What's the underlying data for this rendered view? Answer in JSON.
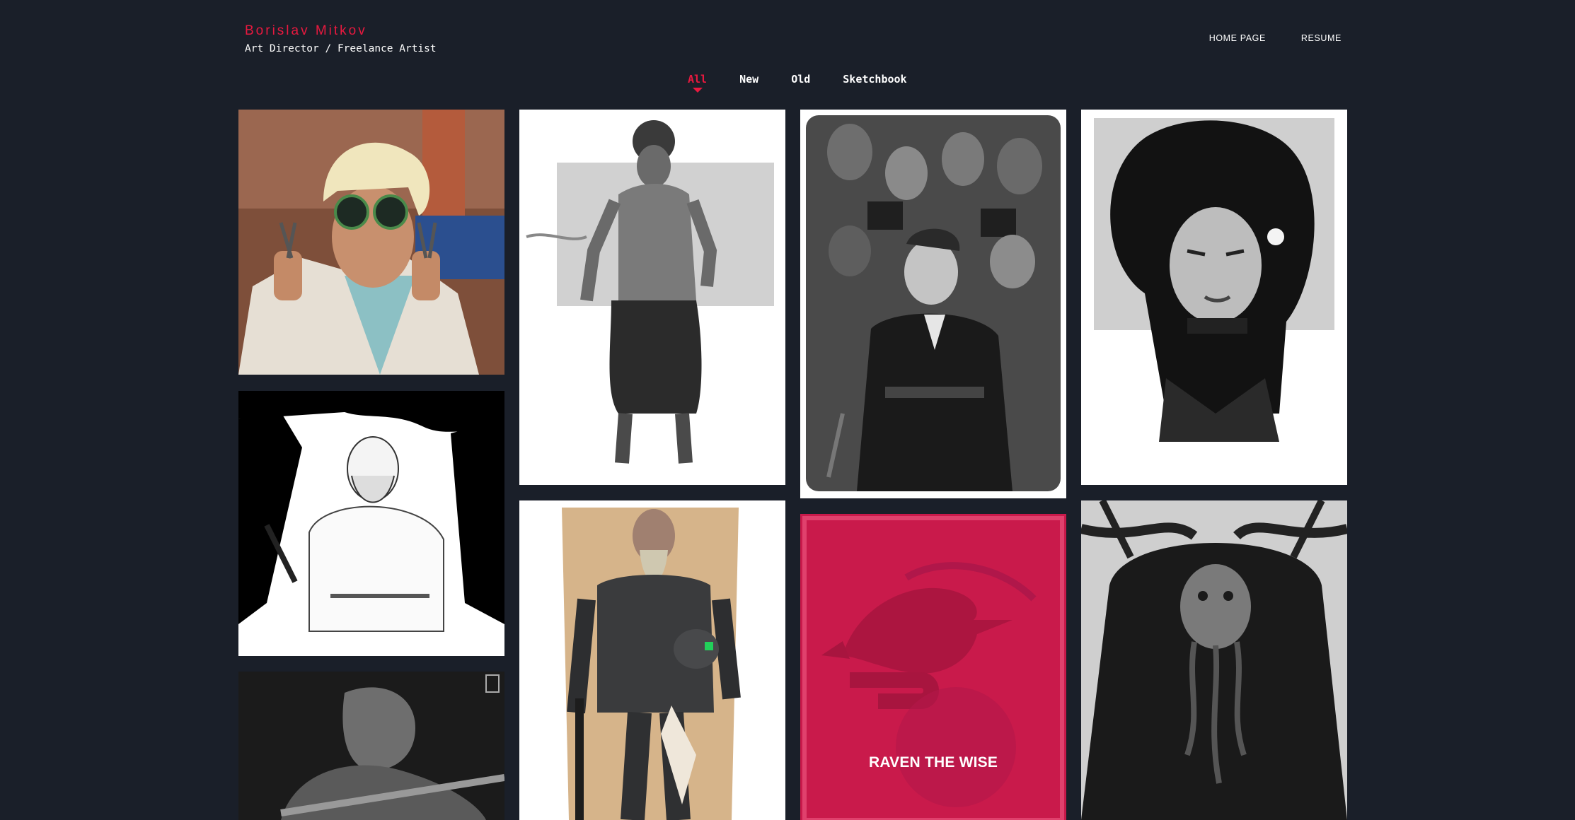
{
  "header": {
    "name": "Borislav Mitkov",
    "role": "Art Director / Freelance Artist"
  },
  "nav": {
    "home": "HOME PAGE",
    "resume": "RESUME"
  },
  "filters": [
    {
      "label": "All",
      "active": true
    },
    {
      "label": "New",
      "active": false
    },
    {
      "label": "Old",
      "active": false
    },
    {
      "label": "Sketchbook",
      "active": false
    }
  ],
  "gallery": {
    "raven_title": "RAVEN THE WISE"
  },
  "colors": {
    "accent": "#e8193f",
    "background": "#1a1f29",
    "raven_card": "#c91a4b"
  }
}
